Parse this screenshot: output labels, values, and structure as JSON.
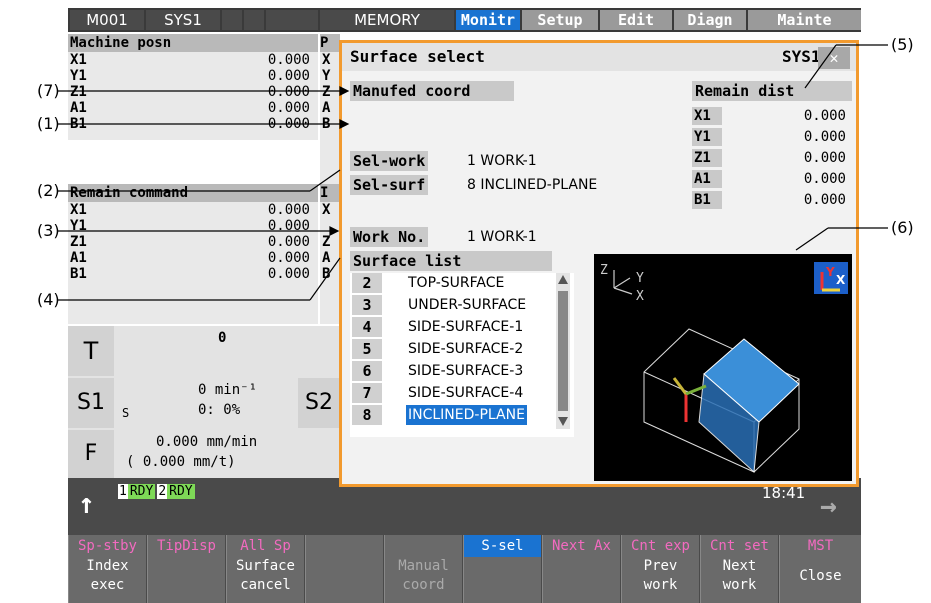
{
  "topbar": {
    "program": "M001",
    "system": "SYS1",
    "mode": "MEMORY",
    "tabs": [
      "Monitr",
      "Setup",
      "Edit",
      "Diagn",
      "Mainte"
    ],
    "active_tab": "Monitr"
  },
  "machine_posn": {
    "title": "Machine posn",
    "axes": [
      {
        "axis": "X1",
        "value": "0.000"
      },
      {
        "axis": "Y1",
        "value": "0.000"
      },
      {
        "axis": "Z1",
        "value": "0.000"
      },
      {
        "axis": "A1",
        "value": "0.000"
      },
      {
        "axis": "B1",
        "value": "0.000"
      }
    ]
  },
  "remain_command": {
    "title": "Remain command",
    "axes": [
      {
        "axis": "X1",
        "value": "0.000"
      },
      {
        "axis": "Y1",
        "value": "0.000"
      },
      {
        "axis": "Z1",
        "value": "0.000"
      },
      {
        "axis": "A1",
        "value": "0.000"
      },
      {
        "axis": "B1",
        "value": "0.000"
      }
    ]
  },
  "side_stub": {
    "letters": [
      "P",
      "X",
      "Y",
      "Z",
      "A",
      "B",
      "I",
      "X",
      "Y",
      "Z",
      "A",
      "B"
    ]
  },
  "tool": {
    "label": "T",
    "value": "0"
  },
  "spindle": {
    "label": "S1",
    "sub": "S",
    "speed": "0 min⁻¹",
    "load": "0: 0%",
    "label2": "S2"
  },
  "feed": {
    "label": "F",
    "rate": "0.000 mm/min",
    "per_rev": "( 0.000 mm/t)"
  },
  "status": {
    "up_arrow": "↑",
    "rdy1_no": "1",
    "rdy1": "RDY",
    "rdy2_no": "2",
    "rdy2": "RDY",
    "time": "18:41",
    "right_arrow": "→"
  },
  "dialog": {
    "title": "Surface select",
    "system": "SYS1",
    "close": "✕",
    "manufed_coord": "Manufed coord",
    "sel_work_label": "Sel-work",
    "sel_work_value": "1 WORK-1",
    "sel_surf_label": "Sel-surf",
    "sel_surf_value": "8 INCLINED-PLANE",
    "work_no_label": "Work No.",
    "work_no_value": "1 WORK-1",
    "remain_dist_title": "Remain dist",
    "remain_dist": [
      {
        "axis": "X1",
        "value": "0.000"
      },
      {
        "axis": "Y1",
        "value": "0.000"
      },
      {
        "axis": "Z1",
        "value": "0.000"
      },
      {
        "axis": "A1",
        "value": "0.000"
      },
      {
        "axis": "B1",
        "value": "0.000"
      }
    ],
    "surface_list_title": "Surface list",
    "surface_list": [
      {
        "no": "2",
        "name": "TOP-SURFACE"
      },
      {
        "no": "3",
        "name": "UNDER-SURFACE"
      },
      {
        "no": "4",
        "name": "SIDE-SURFACE-1"
      },
      {
        "no": "5",
        "name": "SIDE-SURFACE-2"
      },
      {
        "no": "6",
        "name": "SIDE-SURFACE-3"
      },
      {
        "no": "7",
        "name": "SIDE-SURFACE-4"
      },
      {
        "no": "8",
        "name": "INCLINED-PLANE"
      }
    ],
    "selected_surface": "8",
    "view_axes": {
      "z": "Z",
      "y": "Y",
      "x": "X"
    },
    "view_badge": {
      "y": "Y",
      "x": "X"
    }
  },
  "softkeys": [
    {
      "top": "Sp-stby",
      "bottom": [
        "Index",
        "exec"
      ]
    },
    {
      "top": "TipDisp",
      "bottom": [
        "",
        ""
      ]
    },
    {
      "top": "All Sp",
      "bottom": [
        "Surface",
        "cancel"
      ]
    },
    {
      "top": "",
      "bottom": [
        "",
        ""
      ]
    },
    {
      "top": "",
      "bottom": [
        "Manual",
        "coord"
      ]
    },
    {
      "top": "S-sel",
      "bottom": [
        "",
        ""
      ]
    },
    {
      "top": "Next Ax",
      "bottom": [
        "",
        ""
      ]
    },
    {
      "top": "Cnt exp",
      "bottom": [
        "Prev",
        "work"
      ]
    },
    {
      "top": "Cnt set",
      "bottom": [
        "Next",
        "work"
      ]
    },
    {
      "top": "MST",
      "bottom": [
        "Close",
        ""
      ]
    }
  ],
  "callouts": [
    "(5)",
    "(7)",
    "(1)",
    "(2)",
    "(3)",
    "(6)",
    "(4)"
  ],
  "colors": {
    "accent_orange": "#f29a2e",
    "selection_blue": "#1a73d1",
    "rdy_green": "#7ed957",
    "softkey_top": "#f36ac0"
  }
}
